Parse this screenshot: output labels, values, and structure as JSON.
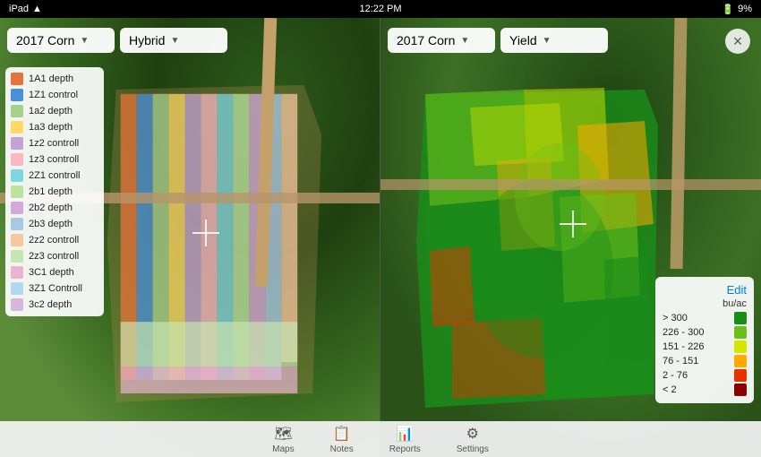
{
  "statusBar": {
    "left": "iPad",
    "time": "12:22 PM",
    "battery": "9%",
    "wifi": true
  },
  "leftPanel": {
    "cropLabel": "2017 Corn",
    "layerLabel": "Hybrid",
    "legend": [
      {
        "label": "1A1 depth",
        "color": "#E8733A"
      },
      {
        "label": "1Z1 control",
        "color": "#4A90D9"
      },
      {
        "label": "1a2 depth",
        "color": "#A8D08D"
      },
      {
        "label": "1a3 depth",
        "color": "#FFD966"
      },
      {
        "label": "1z2 controll",
        "color": "#C5A3D6"
      },
      {
        "label": "1z3 controll",
        "color": "#F9B8C4"
      },
      {
        "label": "2Z1 controll",
        "color": "#7ED6E0"
      },
      {
        "label": "2b1 depth",
        "color": "#B8E4A0"
      },
      {
        "label": "2b2 depth",
        "color": "#D4A8DC"
      },
      {
        "label": "2b3 depth",
        "color": "#A8C8E8"
      },
      {
        "label": "2z2 controll",
        "color": "#F7C59F"
      },
      {
        "label": "2z3 controll",
        "color": "#C8E4B0"
      },
      {
        "label": "3C1 depth",
        "color": "#E8B4D0"
      },
      {
        "label": "3Z1 Controll",
        "color": "#B0D8F0"
      },
      {
        "label": "3c2 depth",
        "color": "#D4B8E0"
      }
    ]
  },
  "rightPanel": {
    "cropLabel": "2017 Corn",
    "layerLabel": "Yield",
    "yieldLegend": {
      "editLabel": "Edit",
      "unit": "bu/ac",
      "ranges": [
        {
          "label": "> 300",
          "color": "#1a8c1a"
        },
        {
          "label": "226 - 300",
          "color": "#6abf1a"
        },
        {
          "label": "151 - 226",
          "color": "#d4e600"
        },
        {
          "label": "76 - 151",
          "color": "#ffaa00"
        },
        {
          "label": "2 - 76",
          "color": "#e63300"
        },
        {
          "label": "< 2",
          "color": "#8B0000"
        }
      ]
    }
  },
  "closeButton": "×",
  "navBar": {
    "items": [
      {
        "icon": "🗺",
        "label": "Maps"
      },
      {
        "icon": "📋",
        "label": "Notes"
      },
      {
        "icon": "📊",
        "label": "Reports"
      },
      {
        "icon": "⚙",
        "label": "Settings"
      }
    ]
  }
}
